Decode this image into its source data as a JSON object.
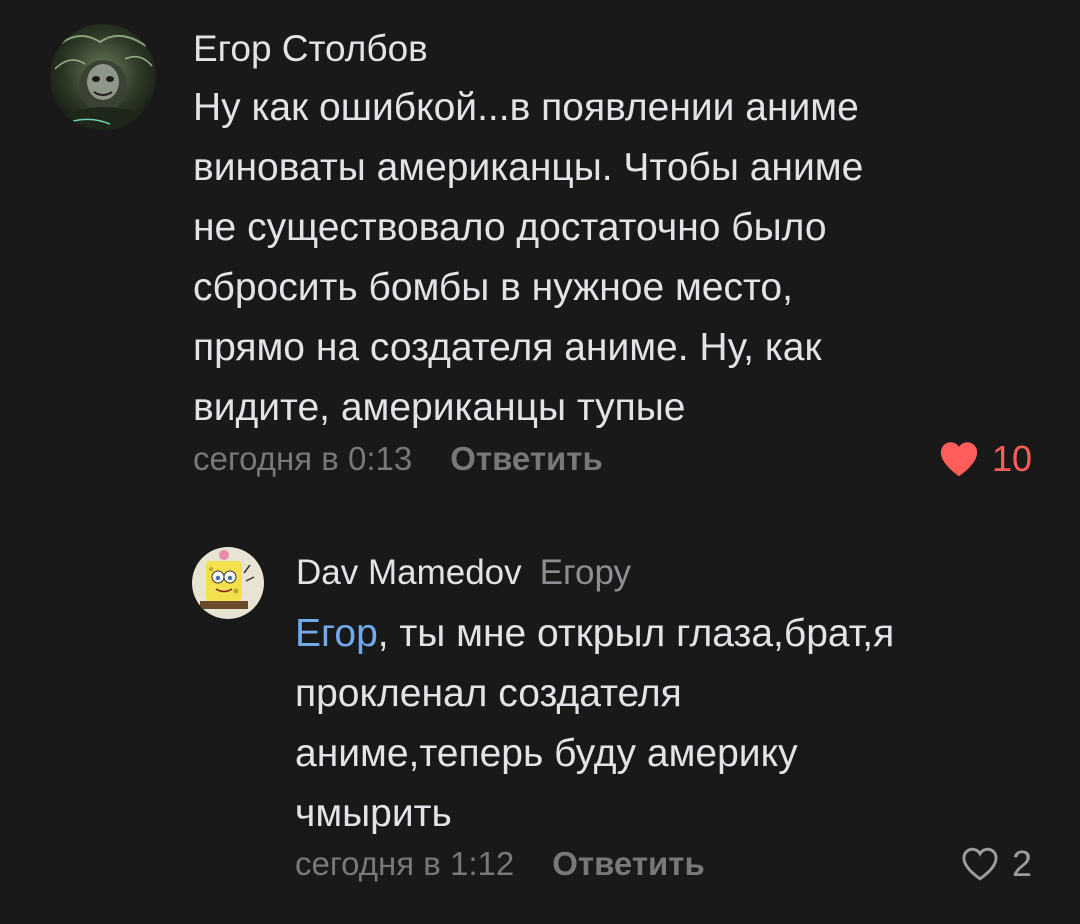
{
  "comments": [
    {
      "author": "Егор Столбов",
      "text_lines": [
        "Ну как ошибкой...в появлении аниме",
        "виноваты американцы. Чтобы аниме",
        "не существовало достаточно было",
        "сбросить бомбы в нужное место,",
        "прямо на создателя аниме. Ну, как",
        "видите, американцы тупые"
      ],
      "time": "сегодня в 0:13",
      "reply_label": "Ответить",
      "likes": "10",
      "liked": true,
      "avatar_icon": "dark-creature-avatar"
    },
    {
      "author": "Dav Mamedov",
      "reply_to": "Егору",
      "mention": "Егор",
      "text_lines": [
        ", ты мне открыл глаза,брат,я",
        "прокленал создателя",
        "аниме,теперь буду америку",
        "чмырить"
      ],
      "time": "сегодня в 1:12",
      "reply_label": "Ответить",
      "likes": "2",
      "liked": false,
      "avatar_icon": "spongebob-avatar"
    }
  ],
  "colors": {
    "background": "#191919",
    "text": "#e1e3e6",
    "secondary": "#76787a",
    "mention": "#71aaeb",
    "like_active": "#ff5c5c"
  }
}
